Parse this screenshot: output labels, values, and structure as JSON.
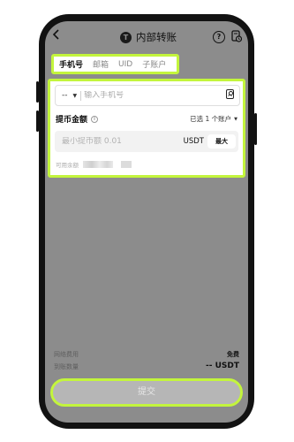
{
  "header": {
    "back_icon": "chevron-left-icon",
    "title": "内部转账",
    "logo_letter": "T",
    "help_icon": "question-circle-icon",
    "records_icon": "document-clock-icon"
  },
  "tabs": [
    {
      "label": "手机号",
      "active": true
    },
    {
      "label": "邮箱",
      "active": false
    },
    {
      "label": "UID",
      "active": false
    },
    {
      "label": "子账户",
      "active": false
    }
  ],
  "phone": {
    "country_code": "--",
    "placeholder": "输入手机号",
    "contact_icon": "contact-book-icon"
  },
  "amount": {
    "label": "提币金额",
    "selected_accounts": "已选 1 个账户",
    "placeholder": "最小提币额 0.01",
    "currency": "USDT",
    "max_label": "最大",
    "available_label": "可用余额"
  },
  "summary": {
    "fee_label": "网络费用",
    "fee_value": "免费",
    "received_label": "到账数量",
    "received_value": "-- USDT"
  },
  "submit_label": "提交",
  "colors": {
    "highlight": "#c3f53c",
    "overlay": "#8c8c8c"
  }
}
